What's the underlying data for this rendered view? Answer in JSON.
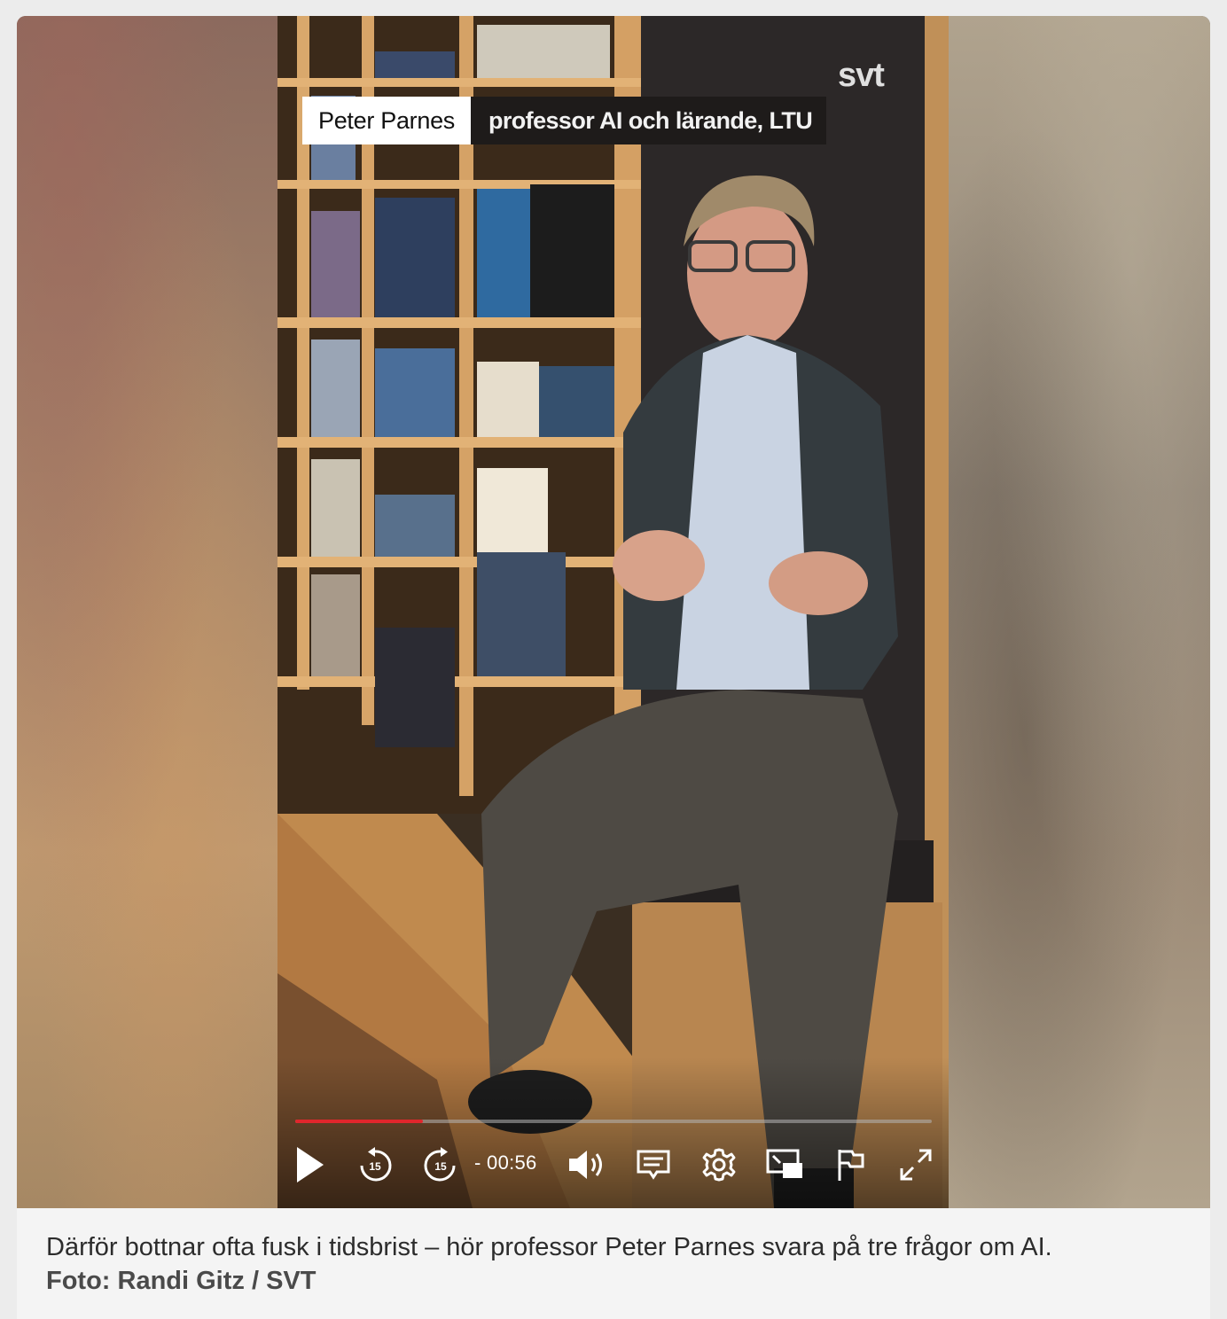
{
  "video": {
    "lower_third": {
      "name": "Peter Parnes",
      "title": "professor AI och lärande, LTU"
    },
    "logo": "svt",
    "progress": 0.2,
    "time_remaining": "- 00:56",
    "controls": {
      "play": "play-icon",
      "rewind": "rewind-15-icon",
      "forward": "forward-15-icon",
      "volume": "volume-icon",
      "subtitles": "subtitles-icon",
      "settings": "settings-gear-icon",
      "pip": "picture-in-picture-icon",
      "report": "flag-icon",
      "fullscreen": "fullscreen-icon"
    },
    "accent_color": "#e0262c"
  },
  "caption": {
    "text": "Därför bottnar ofta fusk i tidsbrist – hör professor Peter Parnes svara på tre frågor om AI.",
    "credit": "Foto: Randi Gitz / SVT"
  }
}
